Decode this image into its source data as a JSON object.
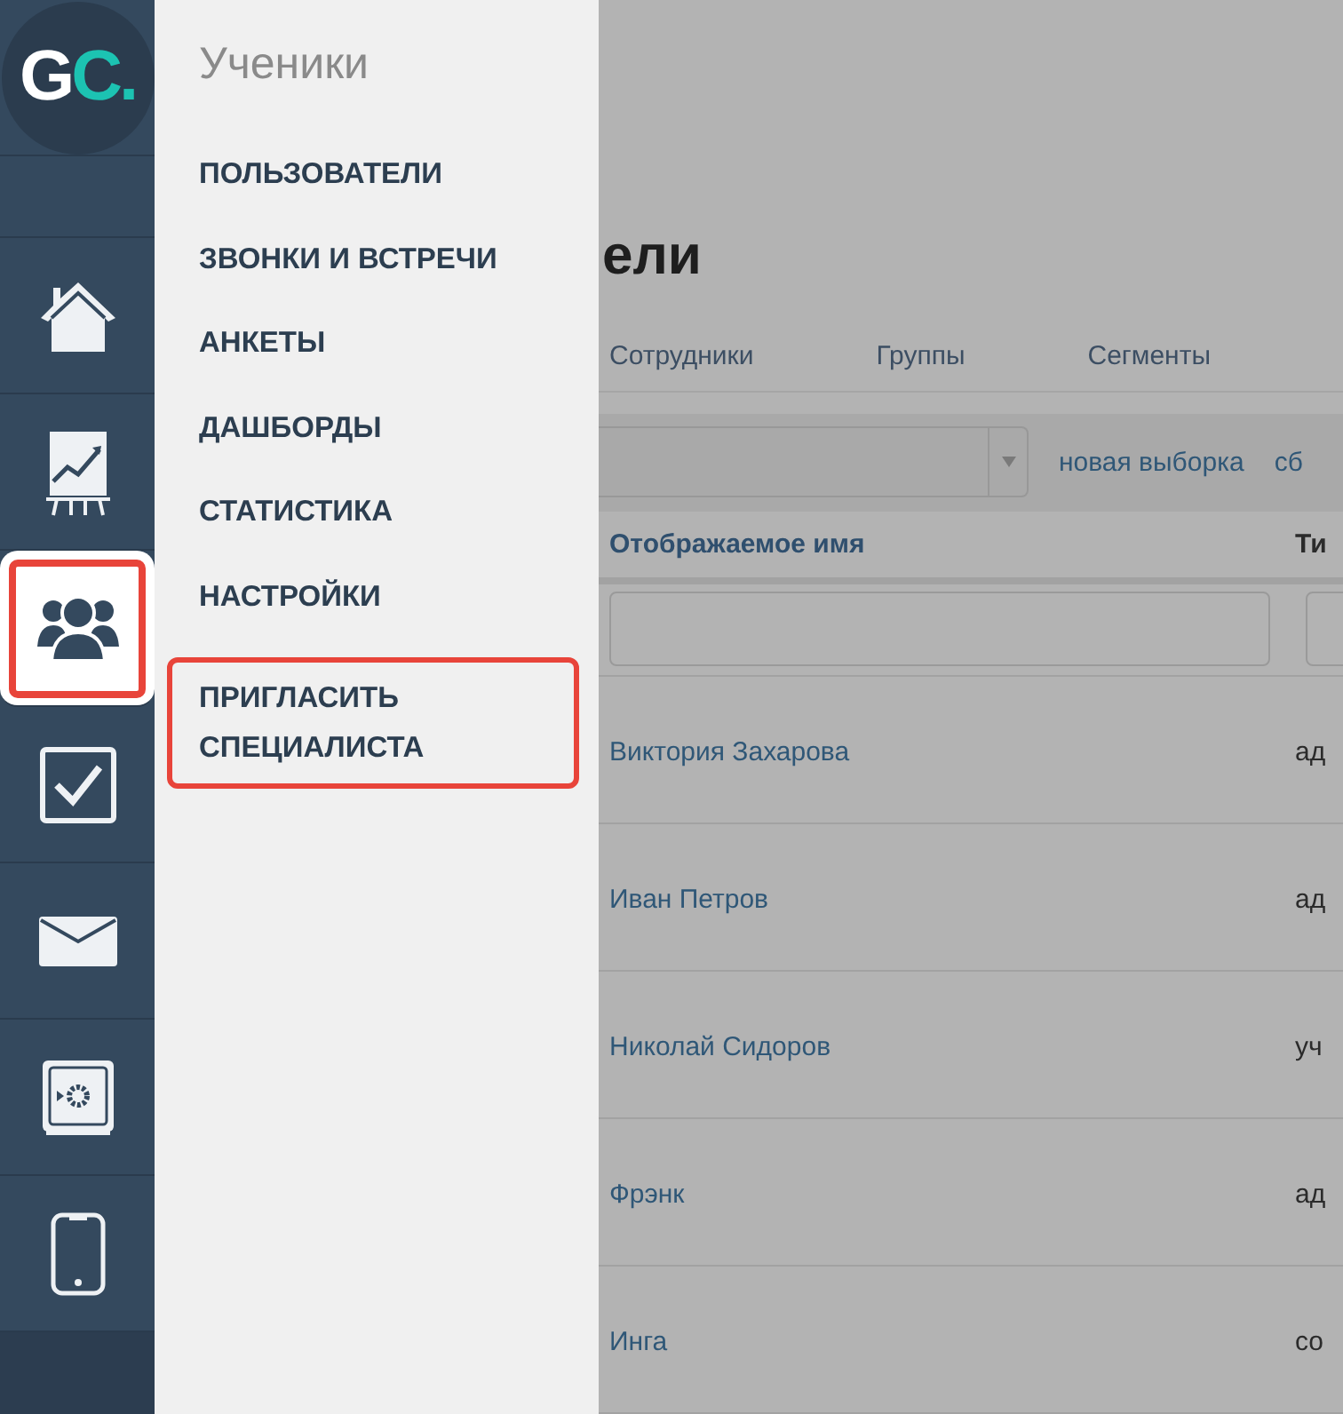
{
  "sidebar": {
    "logo": "GC.",
    "items": [
      {
        "kind": "home",
        "selected": false,
        "highlighted": false
      },
      {
        "kind": "chart",
        "selected": false,
        "highlighted": false
      },
      {
        "kind": "users",
        "selected": true,
        "highlighted": true
      },
      {
        "kind": "tasks",
        "selected": false,
        "highlighted": false
      },
      {
        "kind": "mail",
        "selected": false,
        "highlighted": false
      },
      {
        "kind": "safe",
        "selected": false,
        "highlighted": false
      },
      {
        "kind": "phone",
        "selected": false,
        "highlighted": false
      }
    ]
  },
  "flyout": {
    "title": "Ученики",
    "items": [
      {
        "label": "ПОЛЬЗОВАТЕЛИ",
        "highlighted": false
      },
      {
        "label": "ЗВОНКИ И ВСТРЕЧИ",
        "highlighted": false
      },
      {
        "label": "АНКЕТЫ",
        "highlighted": false
      },
      {
        "label": "ДАШБОРДЫ",
        "highlighted": false
      },
      {
        "label": "СТАТИСТИКА",
        "highlighted": false
      },
      {
        "label": "НАСТРОЙКИ",
        "highlighted": false
      },
      {
        "label": "ПРИГЛАСИТЬ СПЕЦИАЛИСТА",
        "highlighted": true
      }
    ]
  },
  "main": {
    "title": "ели",
    "tabs": [
      "Сотрудники",
      "Группы",
      "Сегменты"
    ],
    "toolbar_links": [
      "новая выборка",
      "сб"
    ],
    "table": {
      "columns": [
        "Отображаемое имя",
        "Ти"
      ],
      "rows": [
        {
          "name": "Виктория Захарова",
          "type": "ад"
        },
        {
          "name": "Иван Петров",
          "type": "ад"
        },
        {
          "name": "Николай Сидоров",
          "type": "уч"
        },
        {
          "name": "Фрэнк",
          "type": "ад"
        },
        {
          "name": "Инга",
          "type": "со"
        }
      ]
    }
  }
}
